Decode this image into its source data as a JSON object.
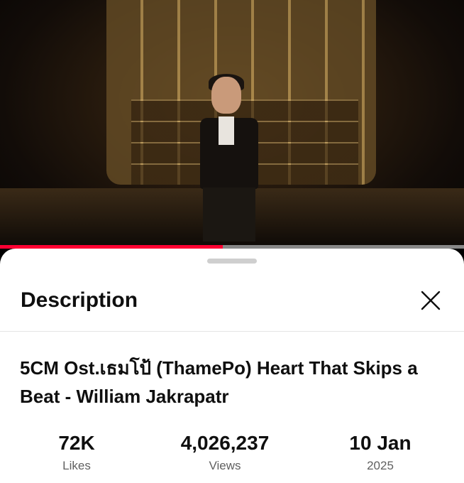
{
  "video": {
    "progress_fraction": 0.48
  },
  "sheet": {
    "title": "Description",
    "video_title": "5CM Ost.เธมโป้ (ThamePo) Heart That Skips a Beat - William Jakrapatr",
    "stats": {
      "likes": {
        "value": "72K",
        "label": "Likes"
      },
      "views": {
        "value": "4,026,237",
        "label": "Views"
      },
      "date": {
        "value": "10 Jan",
        "label": "2025"
      }
    }
  },
  "icons": {
    "close": "close-icon"
  }
}
